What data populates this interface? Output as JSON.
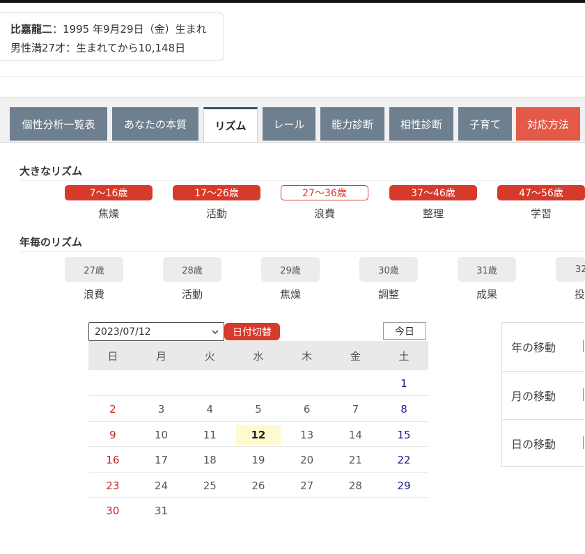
{
  "profile": {
    "name": "比嘉龍二",
    "birth_line": "：1995 年9月29日（金）生まれ",
    "age_line": "男性満27才：生まれてから10,148日"
  },
  "tabs": [
    {
      "label": "個性分析一覧表",
      "state": "normal"
    },
    {
      "label": "あなたの本質",
      "state": "normal"
    },
    {
      "label": "リズム",
      "state": "active"
    },
    {
      "label": "レール",
      "state": "normal"
    },
    {
      "label": "能力診断",
      "state": "normal"
    },
    {
      "label": "相性診断",
      "state": "normal"
    },
    {
      "label": "子育て",
      "state": "normal"
    },
    {
      "label": "対応方法",
      "state": "accent"
    }
  ],
  "big_rhythm": {
    "title": "大きなリズム",
    "items": [
      {
        "range": "7〜16歳",
        "label": "焦燥",
        "current": false
      },
      {
        "range": "17〜26歳",
        "label": "活動",
        "current": false
      },
      {
        "range": "27〜36歳",
        "label": "浪費",
        "current": true
      },
      {
        "range": "37〜46歳",
        "label": "整理",
        "current": false
      },
      {
        "range": "47〜56歳",
        "label": "学習",
        "current": false
      }
    ]
  },
  "yearly_rhythm": {
    "title": "年毎のリズム",
    "items": [
      {
        "age": "27歳",
        "label": "浪費"
      },
      {
        "age": "28歳",
        "label": "活動"
      },
      {
        "age": "29歳",
        "label": "焦燥"
      },
      {
        "age": "30歳",
        "label": "調整"
      },
      {
        "age": "31歳",
        "label": "成果"
      },
      {
        "age": "32",
        "label": "投"
      }
    ]
  },
  "calendar": {
    "selected_date": "2023/07/12",
    "switch_label": "日付切替",
    "today_label": "今日",
    "weekdays": [
      "日",
      "月",
      "火",
      "水",
      "木",
      "金",
      "土"
    ],
    "weeks": [
      [
        "",
        "",
        "",
        "",
        "",
        "",
        "1"
      ],
      [
        "2",
        "3",
        "4",
        "5",
        "6",
        "7",
        "8"
      ],
      [
        "9",
        "10",
        "11",
        "12",
        "13",
        "14",
        "15"
      ],
      [
        "16",
        "17",
        "18",
        "19",
        "20",
        "21",
        "22"
      ],
      [
        "23",
        "24",
        "25",
        "26",
        "27",
        "28",
        "29"
      ],
      [
        "30",
        "31",
        "",
        "",
        "",
        "",
        ""
      ]
    ],
    "today_day": "12"
  },
  "move_panel": {
    "items": [
      "年の移動",
      "月の移動",
      "日の移動"
    ]
  },
  "colors": {
    "tab": "#6e7f8f",
    "tab_accent": "#e35a48",
    "pill": "#d63a2b",
    "sunday": "#cc2222",
    "saturday": "#1a1a8c",
    "today_highlight": "#fdfbcf"
  }
}
